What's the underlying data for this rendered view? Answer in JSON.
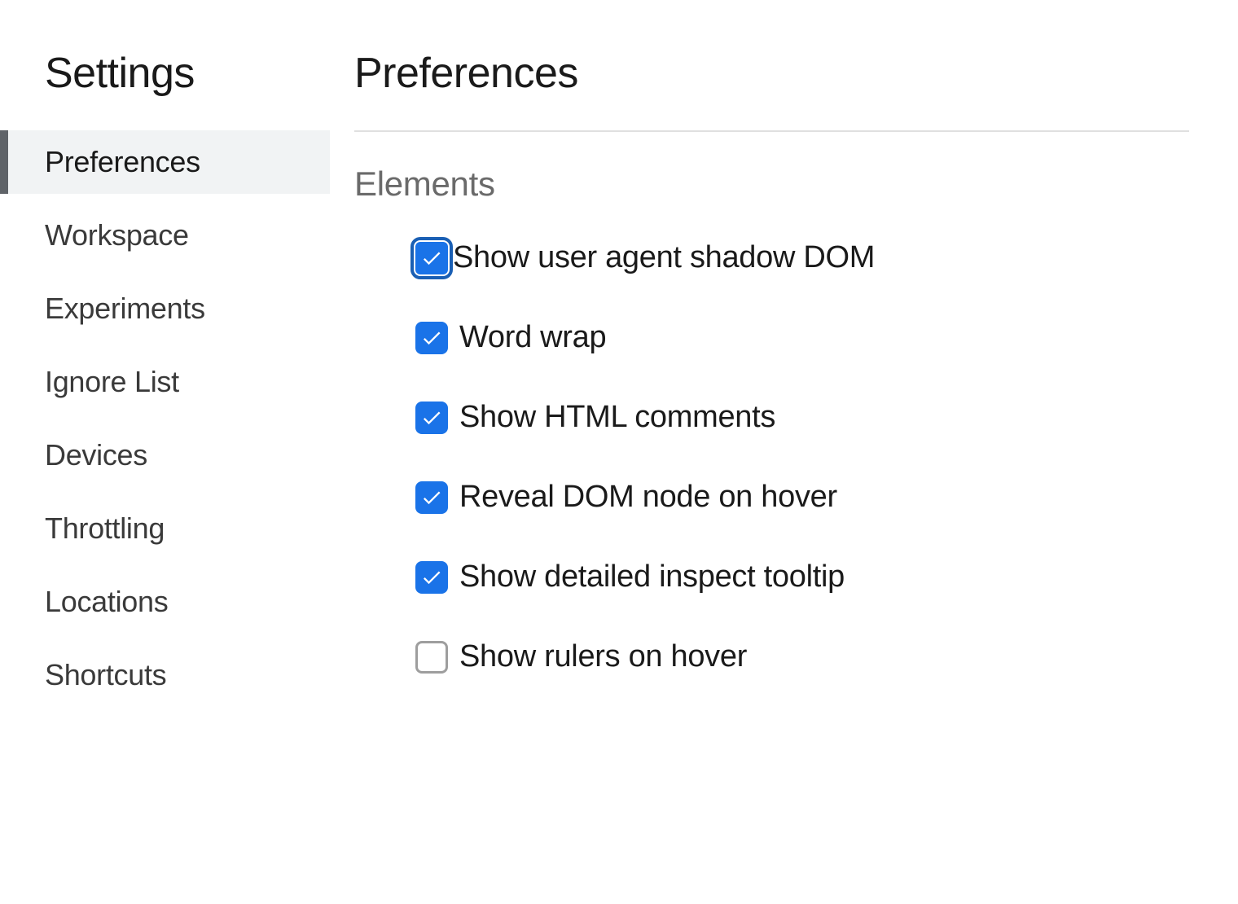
{
  "sidebar": {
    "title": "Settings",
    "items": [
      {
        "label": "Preferences",
        "selected": true
      },
      {
        "label": "Workspace",
        "selected": false
      },
      {
        "label": "Experiments",
        "selected": false
      },
      {
        "label": "Ignore List",
        "selected": false
      },
      {
        "label": "Devices",
        "selected": false
      },
      {
        "label": "Throttling",
        "selected": false
      },
      {
        "label": "Locations",
        "selected": false
      },
      {
        "label": "Shortcuts",
        "selected": false
      }
    ]
  },
  "main": {
    "title": "Preferences",
    "sections": [
      {
        "header": "Elements",
        "options": [
          {
            "label": "Show user agent shadow DOM",
            "checked": true,
            "focused": true
          },
          {
            "label": "Word wrap",
            "checked": true,
            "focused": false
          },
          {
            "label": "Show HTML comments",
            "checked": true,
            "focused": false
          },
          {
            "label": "Reveal DOM node on hover",
            "checked": true,
            "focused": false
          },
          {
            "label": "Show detailed inspect tooltip",
            "checked": true,
            "focused": false
          },
          {
            "label": "Show rulers on hover",
            "checked": false,
            "focused": false
          }
        ]
      }
    ]
  }
}
